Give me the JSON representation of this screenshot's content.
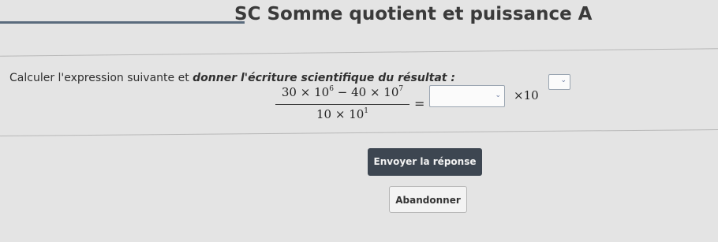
{
  "header": {
    "title": "SC Somme quotient et puissance A"
  },
  "exercise": {
    "instruction_prefix": "Calculer l'expression suivante et ",
    "instruction_emphasis": "donner l'écriture scientifique du résultat :",
    "numerator": {
      "a": "30",
      "times1": "×",
      "base1": "10",
      "exp1": "6",
      "minus": "−",
      "b": "40",
      "times2": "×",
      "base2": "10",
      "exp2": "7"
    },
    "denominator": {
      "a": "10",
      "times": "×",
      "base": "10",
      "exp": "1"
    },
    "equals": "=",
    "times_ten": "×10",
    "mantissa_value": "",
    "exponent_value": ""
  },
  "buttons": {
    "submit_label": "Envoyer la réponse",
    "abandon_label": "Abandonner"
  },
  "icons": {
    "dropdown": "chevron-down-icon"
  }
}
